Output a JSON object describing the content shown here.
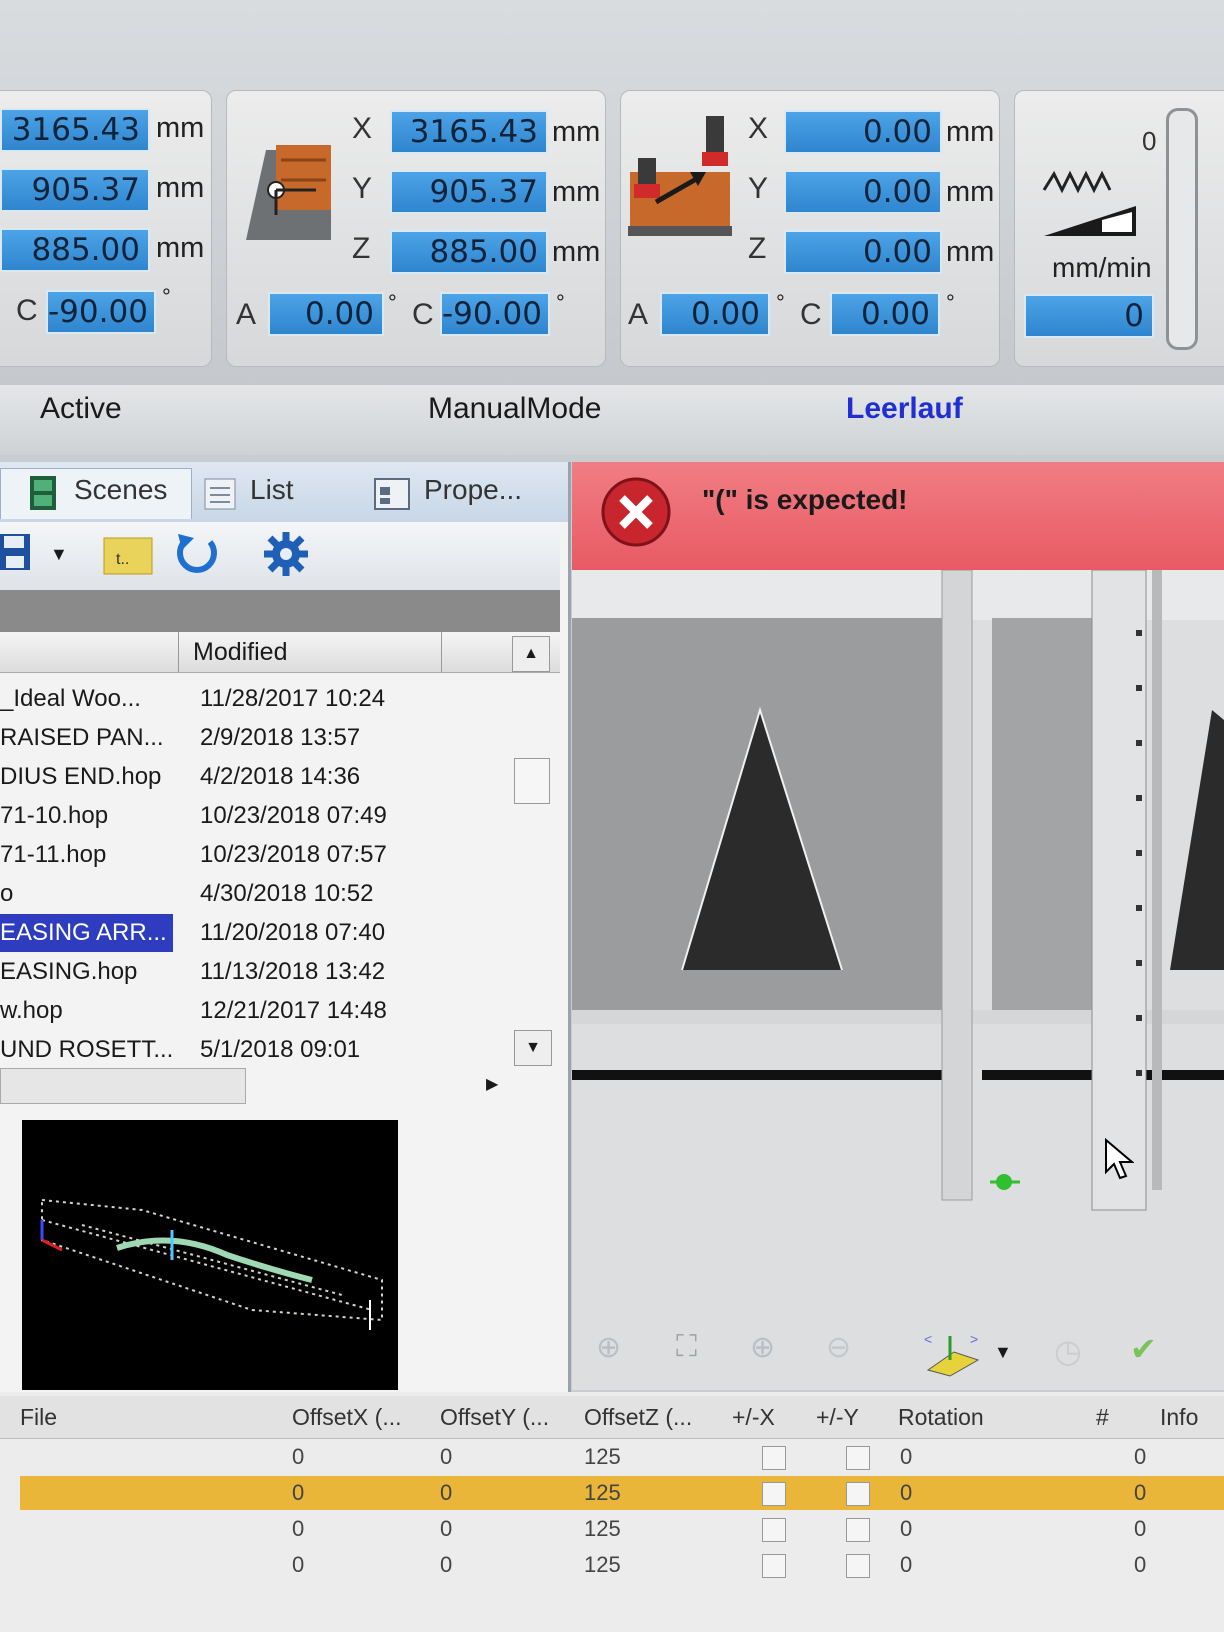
{
  "panel1": {
    "x": "3165.43",
    "y": "905.37",
    "z": "885.00",
    "c_label": "C",
    "c": "-90.00",
    "unit": "mm",
    "deg": "°"
  },
  "panel2": {
    "x_label": "X",
    "y_label": "Y",
    "z_label": "Z",
    "x": "3165.43",
    "y": "905.37",
    "z": "885.00",
    "a_label": "A",
    "a": "0.00",
    "c_label": "C",
    "c": "-90.00",
    "unit": "mm",
    "deg": "°"
  },
  "panel3": {
    "x_label": "X",
    "y_label": "Y",
    "z_label": "Z",
    "x": "0.00",
    "y": "0.00",
    "z": "0.00",
    "a_label": "A",
    "a": "0.00",
    "c_label": "C",
    "c": "0.00",
    "unit": "mm",
    "deg": "°"
  },
  "feed": {
    "top_value": "0",
    "unit": "mm/min",
    "value": "0"
  },
  "status": {
    "state": "Active",
    "mode": "ManualMode",
    "machine": "Leerlauf",
    "machine_color": "#1f2fd1"
  },
  "tabs": {
    "scenes": "Scenes",
    "list": "List",
    "properties": "Prope..."
  },
  "files": {
    "header_modified": "Modified",
    "rows": [
      {
        "name": "_Ideal Woo...",
        "date": "11/28/2017 10:24"
      },
      {
        "name": "RAISED PAN...",
        "date": "2/9/2018 13:57"
      },
      {
        "name": "DIUS END.hop",
        "date": "4/2/2018 14:36"
      },
      {
        "name": "71-10.hop",
        "date": "10/23/2018 07:49"
      },
      {
        "name": "71-11.hop",
        "date": "10/23/2018 07:57"
      },
      {
        "name": "o",
        "date": "4/30/2018 10:52"
      },
      {
        "name": "EASING ARR...",
        "date": "11/20/2018 07:40"
      },
      {
        "name": "EASING.hop",
        "date": "11/13/2018 13:42"
      },
      {
        "name": "w.hop",
        "date": "12/21/2017 14:48"
      },
      {
        "name": "UND ROSETT...",
        "date": "5/1/2018 09:01"
      }
    ],
    "selected_index": 6
  },
  "error": {
    "message": "\"(\" is expected!"
  },
  "grid": {
    "headers": [
      "File",
      "OffsetX (...",
      "OffsetY (...",
      "OffsetZ (...",
      "+/-X",
      "+/-Y",
      "Rotation",
      "#",
      "Info"
    ],
    "rows": [
      {
        "ox": "0",
        "oy": "0",
        "oz": "125",
        "rot": "0",
        "num": "0"
      },
      {
        "ox": "0",
        "oy": "0",
        "oz": "125",
        "rot": "0",
        "num": "0"
      },
      {
        "ox": "0",
        "oy": "0",
        "oz": "125",
        "rot": "0",
        "num": "0"
      },
      {
        "ox": "0",
        "oy": "0",
        "oz": "125",
        "rot": "0",
        "num": "0"
      }
    ],
    "selected_row": 1,
    "selected_color": "#eab63a"
  }
}
